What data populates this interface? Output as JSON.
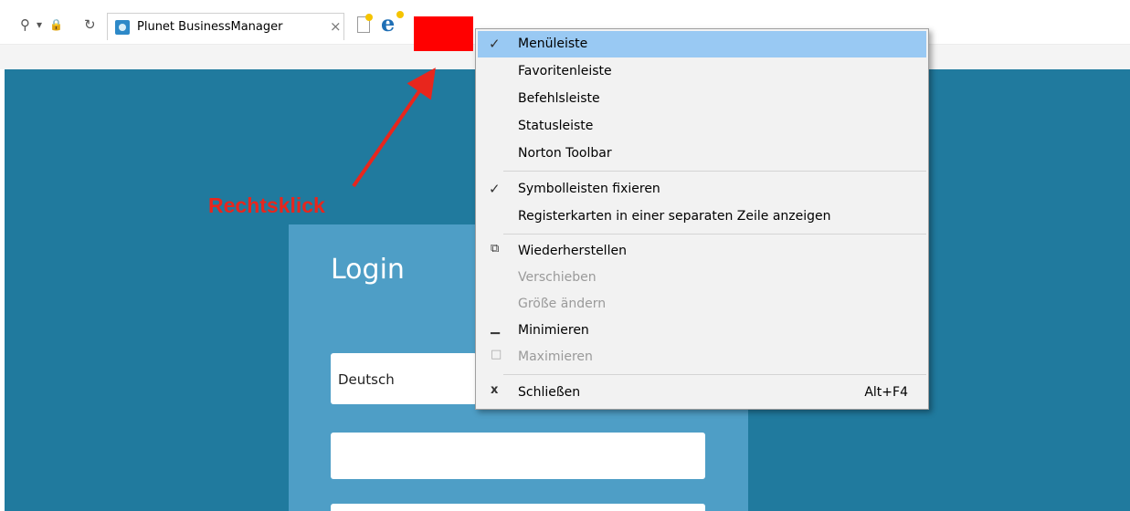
{
  "browser": {
    "tab_title": "Plunet BusinessManager",
    "tab_close": "×",
    "nav_search_icon": "⚲",
    "nav_dropdown_icon": "▾",
    "nav_lock_icon": "🔒",
    "nav_refresh_icon": "↻",
    "ie_logo": "e"
  },
  "annotation": {
    "label": "Rechtsklick",
    "color": "#e8261d"
  },
  "page": {
    "login_title": "Login",
    "language_value": "Deutsch",
    "username_value": "",
    "password_value": "",
    "background_color": "#207a9e",
    "card_color": "#4e9ec6"
  },
  "context_menu": {
    "items": [
      {
        "label": "Menüleiste",
        "checked": true,
        "highlighted": true
      },
      {
        "label": "Favoritenleiste"
      },
      {
        "label": "Befehlsleiste"
      },
      {
        "label": "Statusleiste"
      },
      {
        "label": "Norton Toolbar"
      },
      {
        "label": "Symbolleisten fixieren",
        "checked": true
      },
      {
        "label": "Registerkarten in einer separaten Zeile anzeigen"
      },
      {
        "label": "Wiederherstellen",
        "icon": "restore-icon"
      },
      {
        "label": "Verschieben",
        "disabled": true
      },
      {
        "label": "Größe ändern",
        "disabled": true
      },
      {
        "label": "Minimieren",
        "icon": "minimize-icon"
      },
      {
        "label": "Maximieren",
        "icon": "maximize-icon",
        "disabled": true
      },
      {
        "label": "Schließen",
        "icon": "close-icon",
        "shortcut": "Alt+F4"
      }
    ],
    "check_glyph": "✓",
    "restore_glyph": "⧉",
    "minimize_glyph": "▁",
    "maximize_glyph": "□",
    "close_glyph": "x"
  }
}
